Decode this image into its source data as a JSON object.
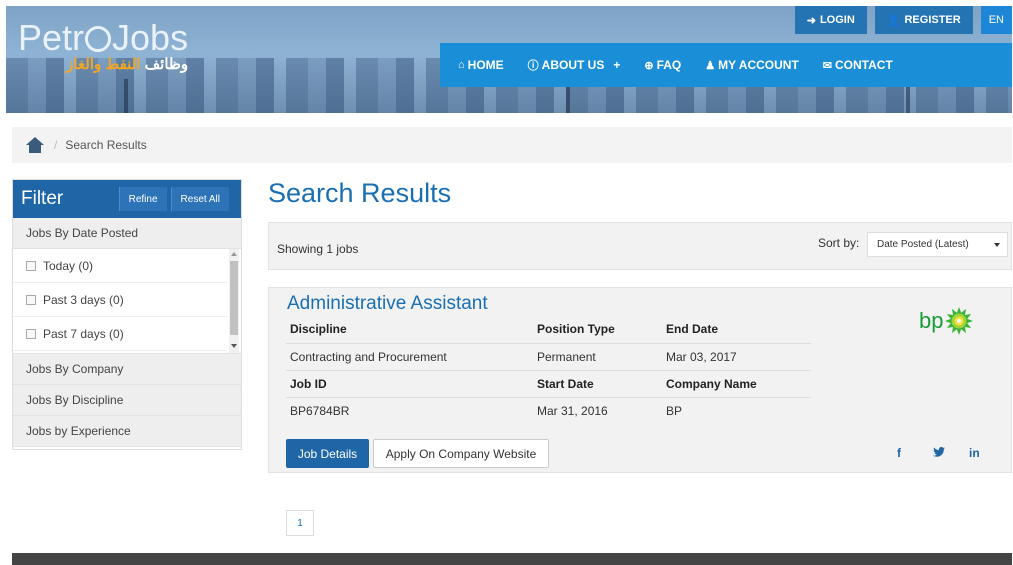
{
  "header": {
    "logo_en_left": "Petr",
    "logo_en_right": "Jobs",
    "logo_ar_a": "وظائف ",
    "logo_ar_b": "النفط والغاز",
    "top_buttons": {
      "login": "LOGIN",
      "register": "REGISTER",
      "language": "EN"
    },
    "nav": {
      "home": "HOME",
      "about": "ABOUT US",
      "about_expand": "+",
      "faq": "FAQ",
      "account": "MY ACCOUNT",
      "contact": "CONTACT"
    },
    "colors": {
      "nav_bg": "#1a8ed6",
      "topbtn_bg": "#2473b3",
      "logo_arabic": "#f3a623"
    }
  },
  "breadcrumb": {
    "home_icon": "home-icon",
    "separator": "/",
    "current": "Search Results"
  },
  "filter": {
    "title": "Filter",
    "refine_label": "Refine",
    "reset_label": "Reset All",
    "sections": {
      "date_posted": "Jobs By Date Posted",
      "company": "Jobs By Company",
      "discipline": "Jobs By Discipline",
      "experience": "Jobs by Experience"
    },
    "date_options": [
      {
        "label": "Today (0)",
        "checked": false
      },
      {
        "label": "Past 3 days (0)",
        "checked": false
      },
      {
        "label": "Past 7 days (0)",
        "checked": false
      }
    ]
  },
  "main": {
    "heading": "Search Results",
    "showing": "Showing 1 jobs",
    "sort_label": "Sort by:",
    "sort_value": "Date Posted (Latest)"
  },
  "job": {
    "title": "Administrative Assistant",
    "headers_row1": [
      "Discipline",
      "Position Type",
      "End Date"
    ],
    "values_row1": [
      "Contracting and Procurement",
      "Permanent",
      "Mar 03, 2017"
    ],
    "headers_row2": [
      "Job ID",
      "Start Date",
      "Company Name"
    ],
    "values_row2": [
      "BP6784BR",
      "Mar 31, 2016",
      "BP"
    ],
    "company_logo_text": "bp",
    "details_button": "Job Details",
    "apply_button": "Apply On Company Website",
    "social": {
      "facebook": "f",
      "twitter": "t",
      "linkedin": "in"
    }
  },
  "pagination": {
    "current": "1"
  }
}
